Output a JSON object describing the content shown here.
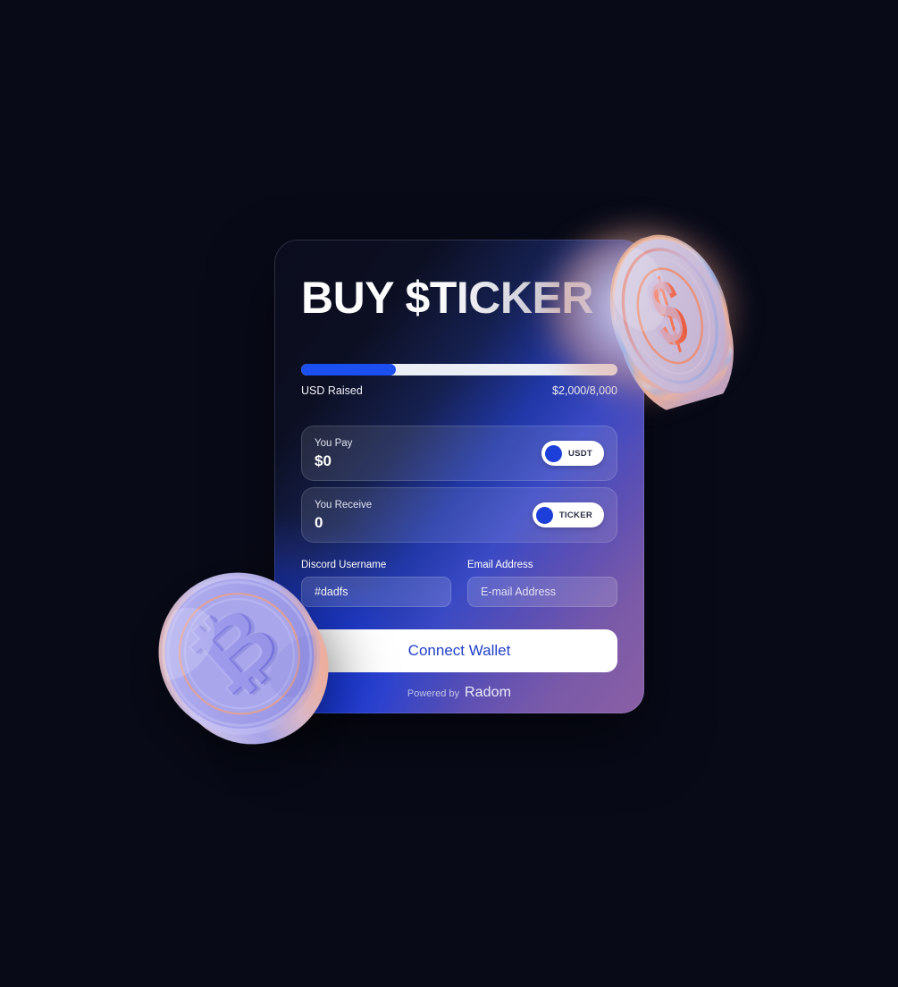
{
  "page": {
    "background_color": "#080a18"
  },
  "card": {
    "title": "BUY $TICKER",
    "progress": {
      "percent": 30,
      "label": "USD Raised",
      "amount": "$2,000/8,000",
      "raised_value": 2000,
      "goal_value": 8000,
      "fill_color": "#1b4ff0",
      "track_color": "#eceef5"
    },
    "swap": [
      {
        "id": "you-pay",
        "label": "You Pay",
        "value": "$0",
        "token": "USDT",
        "token_color": "#1b3fd8"
      },
      {
        "id": "you-receive",
        "label": "You Receive",
        "value": "0",
        "token": "TICKER",
        "token_color": "#1b3fd8"
      }
    ],
    "fields": [
      {
        "id": "discord-username",
        "label": "Discord Username",
        "value": "#dadfs",
        "placeholder": "Discord Username"
      },
      {
        "id": "email-address",
        "label": "Email Address",
        "value": "",
        "placeholder": "E-mail Address"
      }
    ],
    "cta": {
      "label": "Connect Wallet",
      "text_color": "#2040c8",
      "background_color": "#ffffff"
    },
    "footer": {
      "powered_by": "Powered by",
      "brand": "Radom"
    }
  },
  "decorations": {
    "coin_dollar": {
      "name": "dollar-coin",
      "symbol": "$"
    },
    "coin_bitcoin": {
      "name": "bitcoin-coin",
      "symbol": "₿"
    }
  }
}
